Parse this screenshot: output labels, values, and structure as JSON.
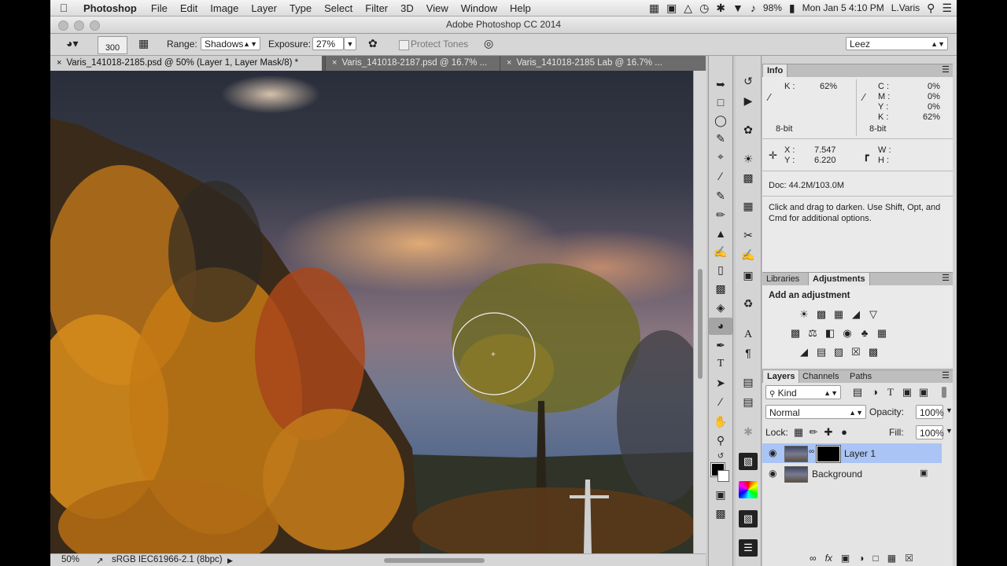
{
  "menubar": {
    "apple": "",
    "app_name": "Photoshop",
    "items": [
      "File",
      "Edit",
      "Image",
      "Layer",
      "Type",
      "Select",
      "Filter",
      "3D",
      "View",
      "Window",
      "Help"
    ],
    "battery": "98%",
    "clock": "Mon Jan 5  4:10 PM",
    "user": "L.Varis"
  },
  "window": {
    "title": "Adobe Photoshop CC 2014"
  },
  "options_bar": {
    "brush_size": "300",
    "range_label": "Range:",
    "range_value": "Shadows",
    "exposure_label": "Exposure:",
    "exposure_value": "27%",
    "protect_tones_label": "Protect Tones",
    "workspace": "Leez"
  },
  "doc_tabs": [
    {
      "label": "Varis_141018-2185.psd @ 50% (Layer 1, Layer Mask/8) *",
      "active": true
    },
    {
      "label": "Varis_141018-2187.psd @ 16.7% ...",
      "active": false
    },
    {
      "label": "Varis_141018-2185 Lab @ 16.7% ...",
      "active": false
    }
  ],
  "status_bar": {
    "zoom": "50%",
    "profile": "sRGB IEC61966-2.1 (8bpc)"
  },
  "info_panel": {
    "tab": "Info",
    "left_k_label": "K :",
    "left_k_value": "62%",
    "c_label": "C :",
    "c_value": "0%",
    "m_label": "M :",
    "m_value": "0%",
    "y_label": "Y :",
    "y_value": "0%",
    "k_label": "K :",
    "k_value": "62%",
    "bit_left": "8-bit",
    "bit_right": "8-bit",
    "x_label": "X :",
    "x_value": "7.547",
    "y2_label": "Y :",
    "y2_value": "6.220",
    "w_label": "W :",
    "h_label": "H :",
    "doc_size": "Doc: 44.2M/103.0M",
    "hint": "Click and drag to darken.  Use Shift, Opt, and Cmd for additional options."
  },
  "adjustments_panel": {
    "tabs": [
      "Libraries",
      "Adjustments"
    ],
    "heading": "Add an adjustment"
  },
  "layers_panel": {
    "tabs": [
      "Layers",
      "Channels",
      "Paths"
    ],
    "filter": "Kind",
    "blend_mode": "Normal",
    "opacity_label": "Opacity:",
    "opacity_value": "100%",
    "lock_label": "Lock:",
    "fill_label": "Fill:",
    "fill_value": "100%",
    "layers": [
      {
        "name": "Layer 1",
        "selected": true
      },
      {
        "name": "Background",
        "selected": false
      }
    ]
  },
  "icons": {
    "eye": "eye-icon",
    "lock": "lock-icon",
    "search": "search-icon"
  },
  "colors": {
    "selected_layer": "#a9c4f5",
    "panel_bg": "#eaeaea",
    "toolbar_bg": "#d4d4d4"
  }
}
